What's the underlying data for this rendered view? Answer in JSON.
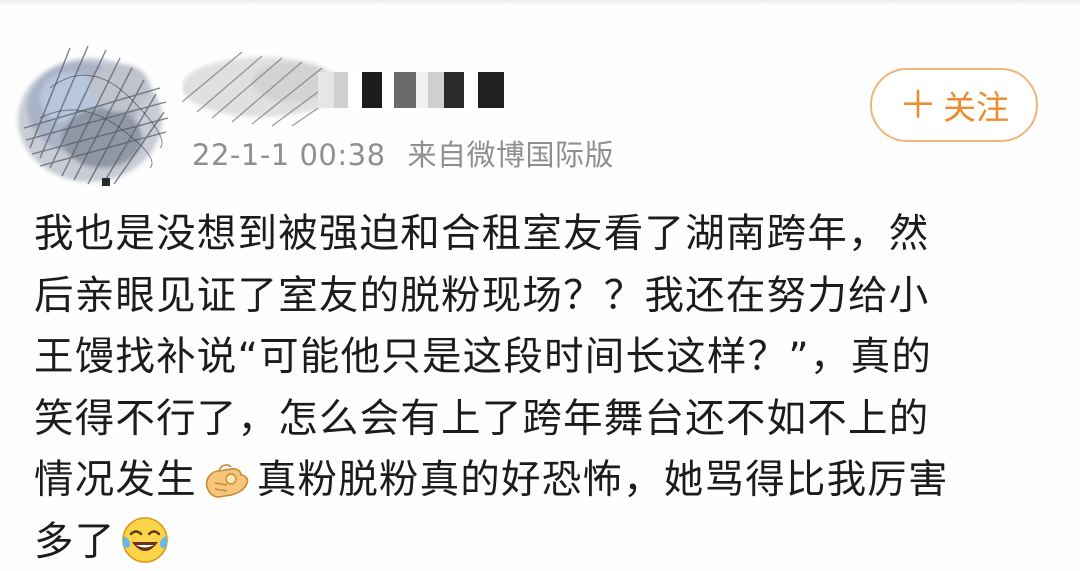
{
  "post": {
    "timestamp": "22-1-1 00:38",
    "source": "来自微博国际版",
    "follow_label": "关注",
    "follow_plus": "＋",
    "content_lines": [
      "我也是没想到被强迫和合租室友看了湖南跨年，然",
      "后亲眼见证了室友的脱粉现场？？我还在努力给小",
      "王馒找补说“可能他只是这段时间长这样？”，真的",
      "笑得不行了，怎么会有上了跨年舞台还不如不上的"
    ],
    "line5_before_emoji": "情况发生",
    "line5_after_emoji": "真粉脱粉真的好恐怖，她骂得比我厉害",
    "line6_text": "多了",
    "emojis": {
      "hand": "ok-hand-emoji",
      "laugh": "crying-laughing-emoji"
    }
  },
  "colors": {
    "follow_accent": "#ee8a2f",
    "follow_border": "#f2b47a",
    "meta_text": "#8f8f8f",
    "body_text": "#1c1c1c"
  }
}
